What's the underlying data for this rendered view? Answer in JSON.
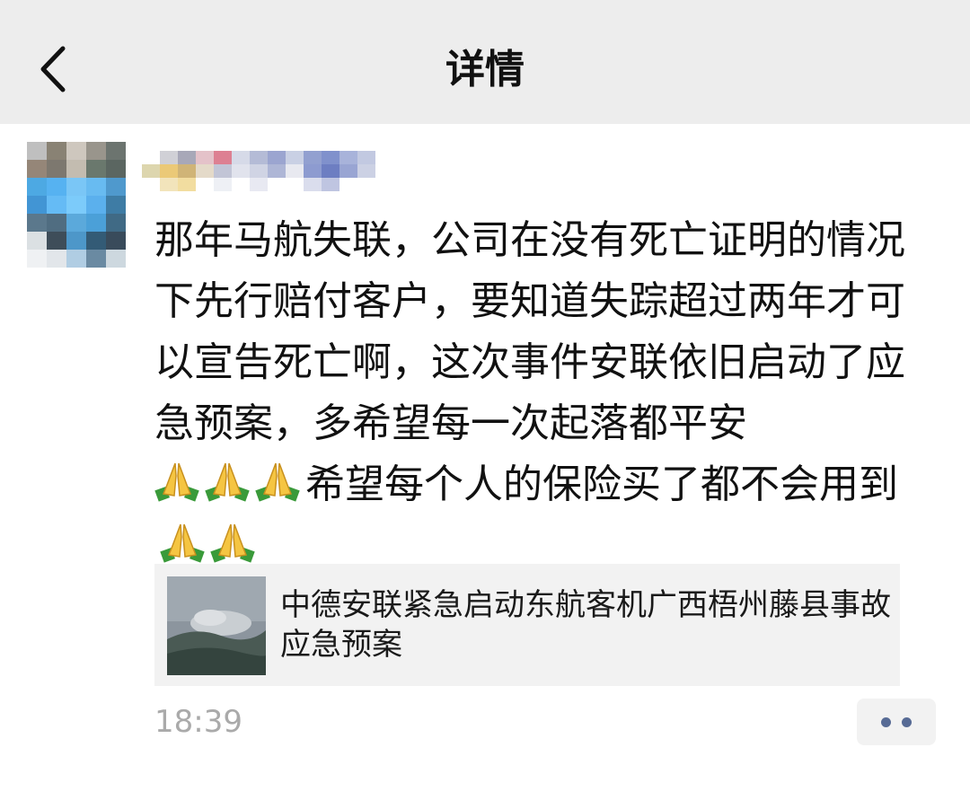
{
  "header": {
    "title": "详情",
    "back_icon": "chevron-left-icon"
  },
  "post": {
    "line1": "那年马航失联，公司在没有死亡证明的情况下先行赔付客户，要知道失踪超过两年才可以宣告死亡啊，这次事件安联依旧启动了应急预案，多希望每一次起落都平安",
    "line2": "希望每个人的保险买了都不会用到",
    "emoji": "folded-hands-icon",
    "time": "18:39"
  },
  "link_card": {
    "title": "中德安联紧急启动东航客机广西梧州藤县事故应急预案"
  },
  "more_icon": "more-dots-icon",
  "colors": {
    "header_bg": "#ededed",
    "link_card_bg": "#f2f2f2",
    "time_color": "#aaaaaa",
    "dots_color": "#576b95"
  }
}
